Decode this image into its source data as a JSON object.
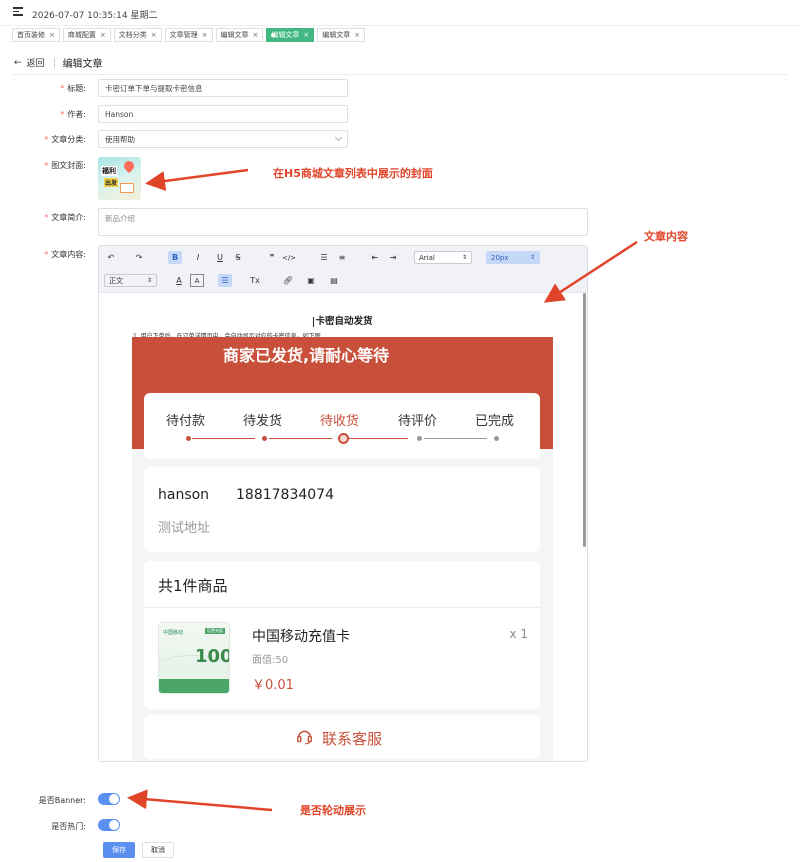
{
  "header": {
    "datetime": "2026-07-07 10:35:14 星期二"
  },
  "tabs": [
    {
      "label": "首页装修",
      "active": false
    },
    {
      "label": "商城配置",
      "active": false
    },
    {
      "label": "文档分类",
      "active": false
    },
    {
      "label": "文章管理",
      "active": false
    },
    {
      "label": "编辑文章",
      "active": false
    },
    {
      "label": "编辑文章",
      "active": true
    },
    {
      "label": "编辑文章",
      "active": false
    }
  ],
  "pagehead": {
    "back": "返回",
    "title": "编辑文章"
  },
  "form": {
    "title_label": "标题:",
    "title_value": "卡密订单下单与提取卡密信息",
    "author_label": "作者:",
    "author_value": "Hanson",
    "category_label": "文章分类:",
    "category_value": "使用帮助",
    "cover_label": "图文封面:",
    "cover_text1": "福利",
    "cover_text2": "出发",
    "summary_label": "文章简介:",
    "summary_value": "新品介绍",
    "content_label": "文章内容:",
    "banner_label": "是否Banner:",
    "hot_label": "是否热门:",
    "banner_on": true,
    "hot_on": true,
    "save_label": "保存",
    "cancel_label": "取消"
  },
  "annotations": {
    "cover": "在H5商城文章列表中展示的封面",
    "content": "文章内容",
    "banner": "是否轮动展示"
  },
  "editor": {
    "font_family": "Arial",
    "font_size": "20px",
    "paragraph": "正文",
    "doc_title": "卡密自动发货",
    "doc_line": "1. 用户下单后，在订单详情页中，会自动显示对应的卡密信息。如下图"
  },
  "screenshot": {
    "banner_text": "商家已发货,请耐心等待",
    "steps": [
      "待付款",
      "待发货",
      "待收货",
      "待评价",
      "已完成"
    ],
    "current_step": 2,
    "name": "hanson",
    "phone": "18817834074",
    "address": "测试地址",
    "goods_head": "共1件商品",
    "goods_name": "中国移动充值卡",
    "goods_qty": "x 1",
    "goods_face": "面值:50",
    "goods_price": "￥0.01",
    "card_brand": "中国移动",
    "card_tag": "话费充值",
    "card_value": "100",
    "service": "联系客服"
  },
  "colors": {
    "accent": "#5b8ff0",
    "tab_active": "#42b983",
    "annotation": "#e0452a",
    "brand_red": "#c8503a"
  }
}
